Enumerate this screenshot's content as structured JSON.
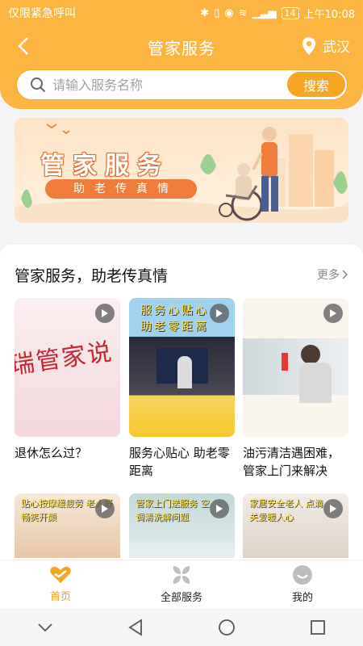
{
  "status_bar": {
    "carrier": "仅限紧急呼叫",
    "battery": "14",
    "time": "上午10:08"
  },
  "header": {
    "title": "管家服务",
    "location": "武汉"
  },
  "search": {
    "placeholder": "请输入服务名称",
    "button_label": "搜索"
  },
  "banner": {
    "title": "管家服务",
    "subtitle": "助老传真情"
  },
  "section": {
    "title": "管家服务，助老传真情",
    "more_label": "更多",
    "cards": [
      {
        "title": "退休怎么过？",
        "thumb_text": "瑞管家说"
      },
      {
        "title": "服务心贴心  助老零距离",
        "thumb_text_top": "服务心贴心",
        "thumb_text_bottom": "助老零距离"
      },
      {
        "title": "油污清洁遇困难，管家上门来解决"
      }
    ],
    "cards_row2": [
      {
        "thumb_text": "贴心按摩缓疲劳 老人舒畅笑开颜"
      },
      {
        "thumb_text": "管家上门送服务 空调清洗解问题"
      },
      {
        "thumb_text": "家居安全老人 点滴关爱暖人心"
      }
    ]
  },
  "tabbar": {
    "items": [
      {
        "label": "首页",
        "active": true
      },
      {
        "label": "全部服务"
      },
      {
        "label": "我的"
      }
    ]
  },
  "colors": {
    "brand": "#fbb540",
    "accent": "#f6a623",
    "active_tab": "#f29f1d"
  }
}
